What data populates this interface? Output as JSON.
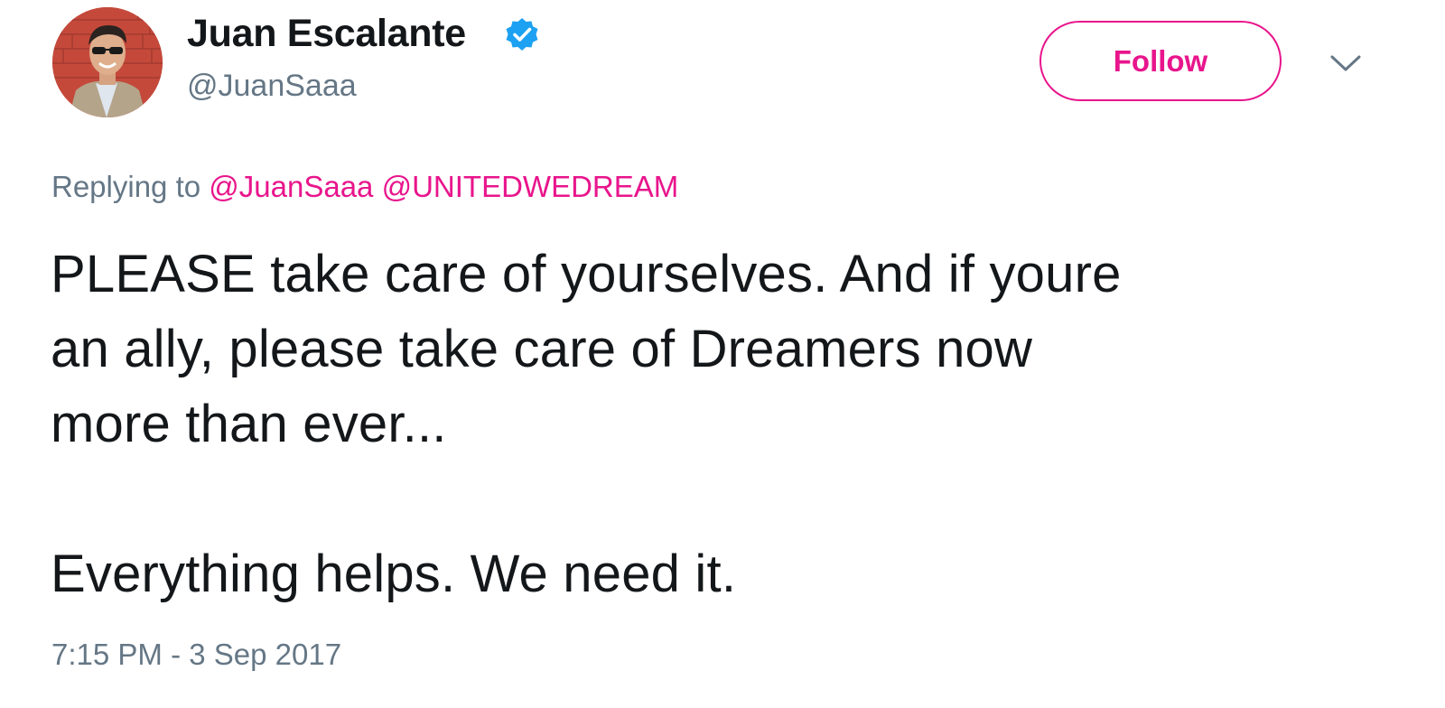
{
  "author": {
    "name": "Juan Escalante",
    "handle": "@JuanSaaa",
    "verified_icon": "verified-badge-icon",
    "avatar_icon": "profile-photo"
  },
  "actions": {
    "follow_label": "Follow",
    "menu_icon": "chevron-down-icon"
  },
  "reply": {
    "prefix": "Replying to",
    "mentions": [
      "@JuanSaaa",
      "@UNITEDWEDREAM"
    ]
  },
  "tweet": {
    "line1": "PLEASE take care of yourselves. And if youre",
    "line2": "an ally, please take care of Dreamers now",
    "line3": "more than ever...",
    "line4": "Everything helps. We need it."
  },
  "meta": {
    "timestamp": "7:15 PM - 3 Sep 2017"
  },
  "colors": {
    "accent": "#e8158c",
    "verified": "#1da1f2",
    "secondary_text": "#657786",
    "primary_text": "#14171a"
  }
}
